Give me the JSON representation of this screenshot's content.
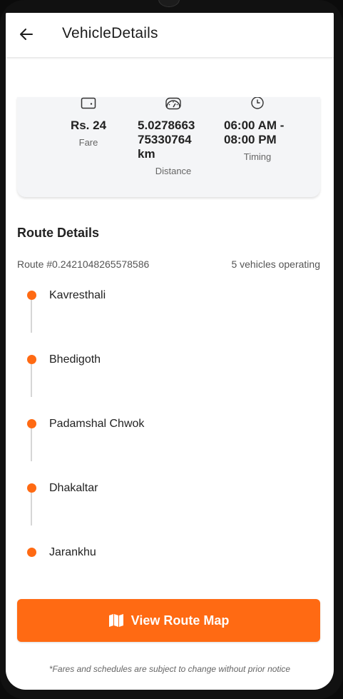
{
  "header": {
    "title": "VehicleDetails"
  },
  "stats": {
    "fare": {
      "value": "Rs. 24",
      "label": "Fare"
    },
    "distance": {
      "value_lines": [
        "5.0278663",
        "75330764",
        "km"
      ],
      "label": "Distance"
    },
    "timing": {
      "value_lines": [
        "06:00 AM -",
        "08:00 PM"
      ],
      "label": "Timing"
    }
  },
  "route": {
    "title": "Route Details",
    "id_text": "Route #0.2421048265578586",
    "vehicles_text": "5 vehicles operating",
    "stops": [
      "Kavresthali",
      "Bhedigoth",
      "Padamshal Chwok",
      "Dhakaltar",
      "Jarankhu"
    ]
  },
  "actions": {
    "view_map_label": "View Route Map"
  },
  "footer": {
    "note": "*Fares and schedules are subject to change without prior notice"
  },
  "colors": {
    "accent": "#ff6a13",
    "card_bg": "#f4f5f7"
  }
}
